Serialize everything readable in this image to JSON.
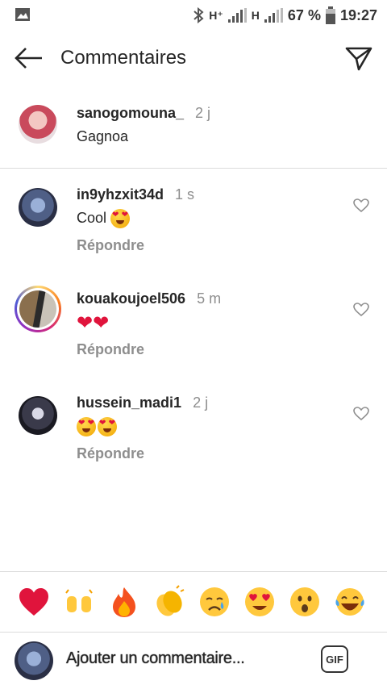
{
  "status_bar": {
    "network_1": "H⁺",
    "network_2": "H",
    "battery_percent": "67 %",
    "time": "19:27"
  },
  "header": {
    "title": "Commentaires"
  },
  "caption": {
    "username": "sanogomouna_",
    "time": "2 j",
    "text": "Gagnoa"
  },
  "comments": [
    {
      "username": "in9yhzxit34d",
      "time": "1 s",
      "text": "Cool",
      "emojis": [
        "heart-eyes-emoji"
      ],
      "reply_label": "Répondre"
    },
    {
      "username": "kouakoujoel506",
      "time": "5 m",
      "text": "",
      "emojis": [
        "red-heart-emoji",
        "red-heart-emoji"
      ],
      "reply_label": "Répondre"
    },
    {
      "username": "hussein_madi1",
      "time": "2 j",
      "text": "",
      "emojis": [
        "heart-eyes-emoji",
        "heart-eyes-emoji"
      ],
      "reply_label": "Répondre"
    }
  ],
  "reactions": [
    "red-heart",
    "raising-hands",
    "fire",
    "clapping-hands",
    "crying-face",
    "heart-eyes",
    "astonished-face",
    "tears-of-joy"
  ],
  "composer": {
    "placeholder": "Ajouter un commentaire...",
    "gif_label": "GIF"
  },
  "colors": {
    "username": "#262626",
    "secondary": "#8e8e8e",
    "divider": "#dbdbdb",
    "story_ring": "#d6249f"
  }
}
